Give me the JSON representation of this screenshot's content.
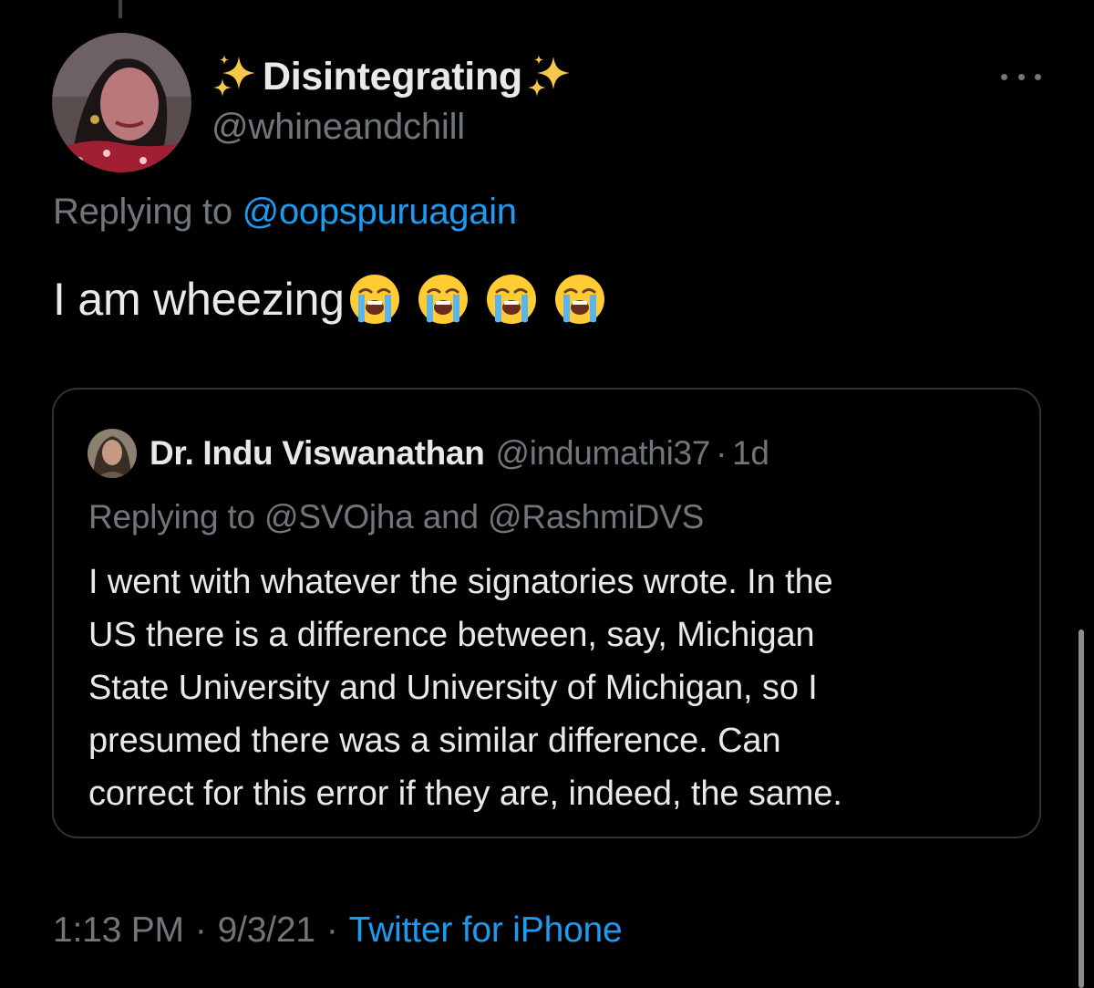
{
  "tweet": {
    "author": {
      "display_name": "Disintegrating",
      "name_decoration_icon": "sparkles-icon",
      "handle": "@whineandchill"
    },
    "menu_icon": "more-horizontal-icon",
    "replying_prefix": "Replying to",
    "replying_mention": "@oopspuruagain",
    "text": "I am wheezing",
    "emoji": [
      "loudly-crying-face-icon",
      "loudly-crying-face-icon",
      "loudly-crying-face-icon",
      "loudly-crying-face-icon"
    ],
    "time": "1:13 PM",
    "date": "9/3/21",
    "separator": "·",
    "source": "Twitter for iPhone"
  },
  "quoted_tweet": {
    "author_name": "Dr. Indu Viswanathan",
    "author_handle": "@indumathi37",
    "separator": "·",
    "time_ago": "1d",
    "replying_prefix": "Replying to",
    "replying_mention_1": "@SVOjha",
    "replying_and": "and",
    "replying_mention_2": "@RashmiDVS",
    "text_lines": [
      "I went with whatever the signatories wrote. In the",
      "US there is a difference between, say, Michigan",
      "State University and University of Michigan, so I",
      "presumed there was a similar difference. Can",
      "correct for this error if they are, indeed, the same."
    ]
  },
  "colors": {
    "background": "#000000",
    "primary_text": "#e7e9ea",
    "secondary_text": "#71767b",
    "link": "#1d9bf0",
    "border": "#2f3336"
  }
}
